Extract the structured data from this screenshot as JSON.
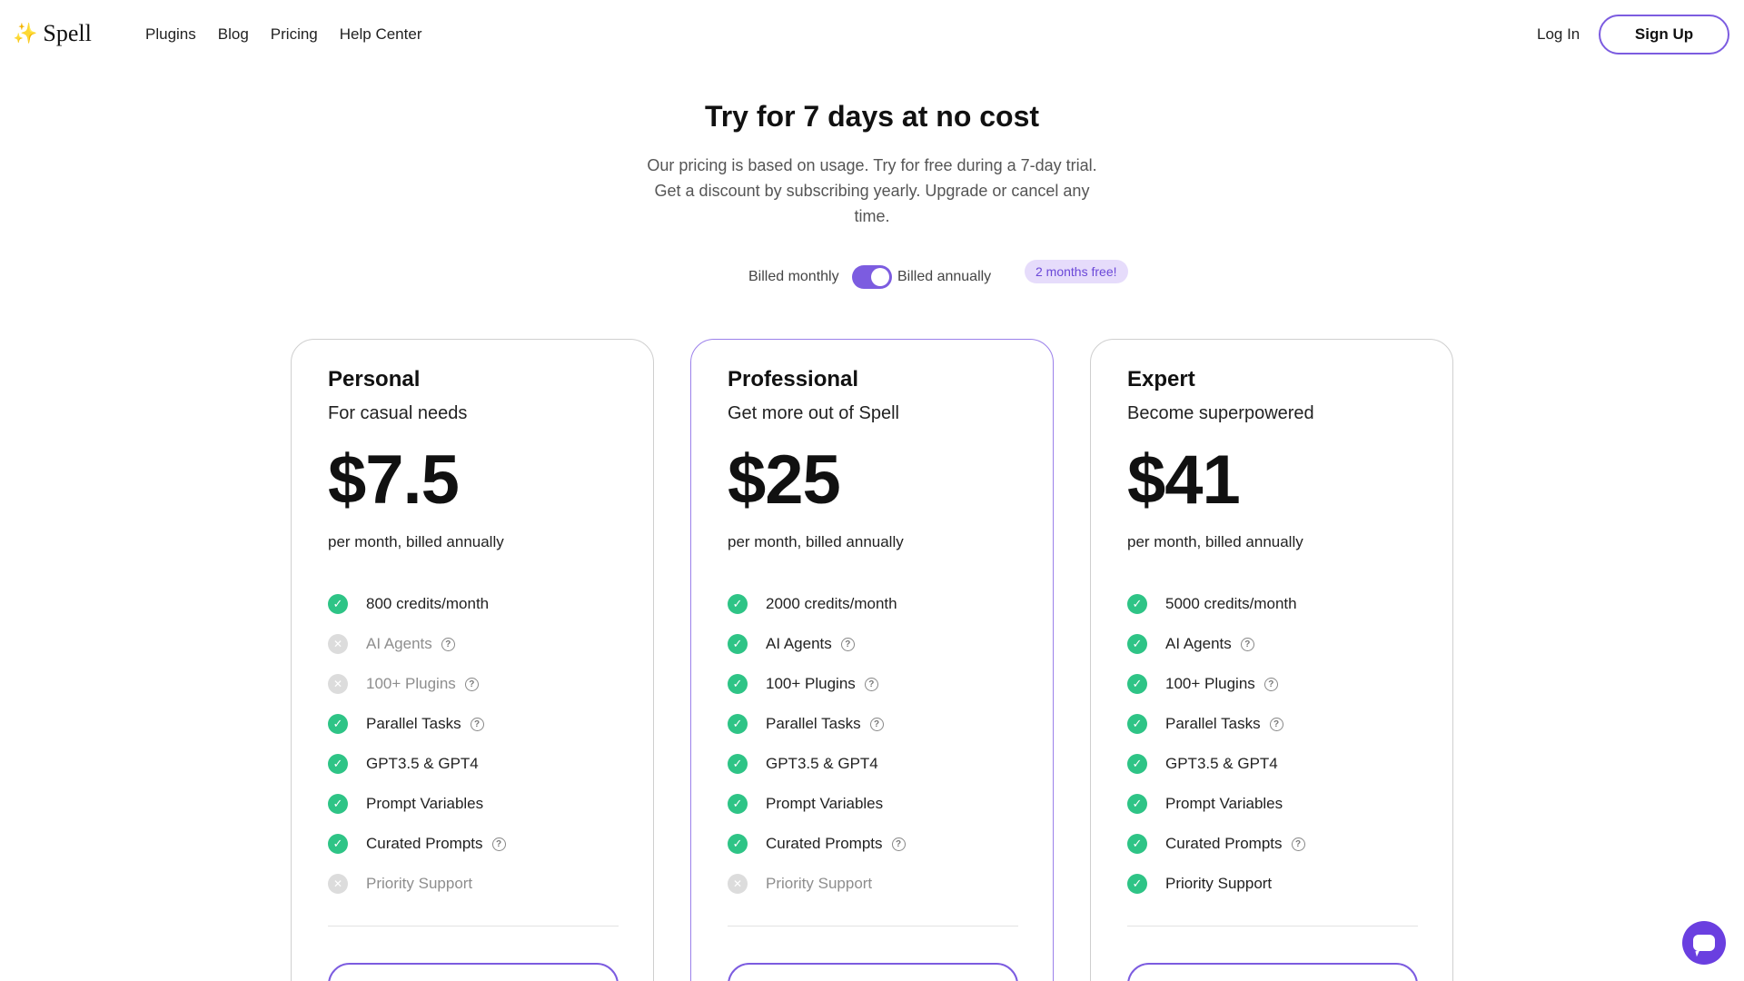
{
  "brand": {
    "name": "Spell",
    "spark_color": "#f5c23a"
  },
  "nav": {
    "items": [
      "Plugins",
      "Blog",
      "Pricing",
      "Help Center"
    ]
  },
  "auth": {
    "login_label": "Log In",
    "signup_label": "Sign Up"
  },
  "hero": {
    "title": "Try for 7 days at no cost",
    "subtitle": "Our pricing is based on usage. Try for free during a 7-day trial. Get a discount by subscribing yearly. Upgrade or cancel any time."
  },
  "billing": {
    "monthly_label": "Billed monthly",
    "annual_label": "Billed annually",
    "annual_selected": true,
    "badge": "2 months free!"
  },
  "colors": {
    "accent": "#7c5ce0",
    "check": "#2ec486",
    "badge_bg": "#e6dcfb"
  },
  "plans": [
    {
      "name": "Personal",
      "tagline": "For casual needs",
      "price": "$7.5",
      "period": "per month, billed annually",
      "featured": false,
      "features": [
        {
          "label": "800 credits/month",
          "included": true,
          "help": false
        },
        {
          "label": "AI Agents",
          "included": false,
          "help": true
        },
        {
          "label": "100+ Plugins",
          "included": false,
          "help": true
        },
        {
          "label": "Parallel Tasks",
          "included": true,
          "help": true
        },
        {
          "label": "GPT3.5 & GPT4",
          "included": true,
          "help": false
        },
        {
          "label": "Prompt Variables",
          "included": true,
          "help": false
        },
        {
          "label": "Curated Prompts",
          "included": true,
          "help": true
        },
        {
          "label": "Priority Support",
          "included": false,
          "help": false
        }
      ]
    },
    {
      "name": "Professional",
      "tagline": "Get more out of Spell",
      "price": "$25",
      "period": "per month, billed annually",
      "featured": true,
      "features": [
        {
          "label": "2000 credits/month",
          "included": true,
          "help": false
        },
        {
          "label": "AI Agents",
          "included": true,
          "help": true
        },
        {
          "label": "100+ Plugins",
          "included": true,
          "help": true
        },
        {
          "label": "Parallel Tasks",
          "included": true,
          "help": true
        },
        {
          "label": "GPT3.5 & GPT4",
          "included": true,
          "help": false
        },
        {
          "label": "Prompt Variables",
          "included": true,
          "help": false
        },
        {
          "label": "Curated Prompts",
          "included": true,
          "help": true
        },
        {
          "label": "Priority Support",
          "included": false,
          "help": false
        }
      ]
    },
    {
      "name": "Expert",
      "tagline": "Become superpowered",
      "price": "$41",
      "period": "per month, billed annually",
      "featured": false,
      "features": [
        {
          "label": "5000 credits/month",
          "included": true,
          "help": false
        },
        {
          "label": "AI Agents",
          "included": true,
          "help": true
        },
        {
          "label": "100+ Plugins",
          "included": true,
          "help": true
        },
        {
          "label": "Parallel Tasks",
          "included": true,
          "help": true
        },
        {
          "label": "GPT3.5 & GPT4",
          "included": true,
          "help": false
        },
        {
          "label": "Prompt Variables",
          "included": true,
          "help": false
        },
        {
          "label": "Curated Prompts",
          "included": true,
          "help": true
        },
        {
          "label": "Priority Support",
          "included": true,
          "help": false
        }
      ]
    }
  ]
}
